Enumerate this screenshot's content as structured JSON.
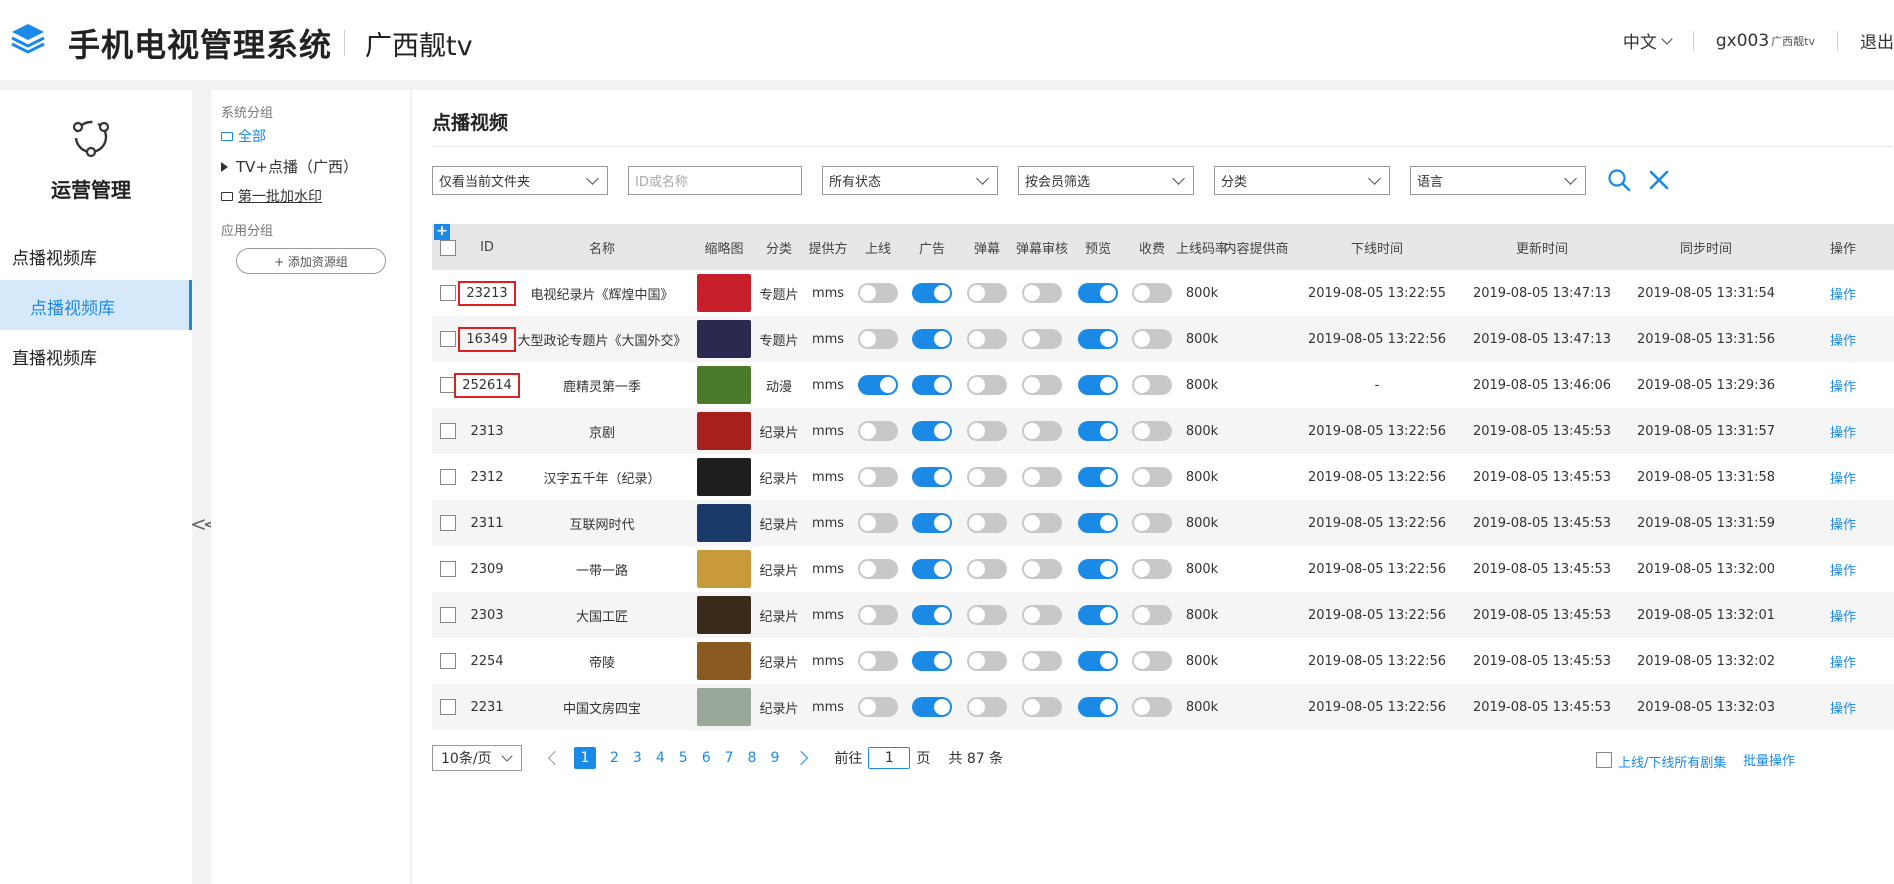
{
  "header": {
    "app_title": "手机电视管理系统",
    "org_name": "广西靓tv",
    "language": "中文",
    "user": "gx003",
    "user_org": "广西靓tv",
    "logout": "退出"
  },
  "leftnav": {
    "title": "运营管理",
    "group1": "点播视频库",
    "active_item": "点播视频库",
    "group2": "直播视频库",
    "collapse": "<<"
  },
  "tree": {
    "system_label": "系统分组",
    "all": "全部",
    "tv_node": "TV+点播（广西）",
    "watermark_node": "第一批加水印",
    "app_label": "应用分组",
    "add_group": "+ 添加资源组"
  },
  "main": {
    "title": "点播视频",
    "filters": {
      "scope": "仅看当前文件夹",
      "search_placeholder": "ID或名称",
      "status": "所有状态",
      "member": "按会员筛选",
      "category": "分类",
      "language": "语言"
    }
  },
  "table": {
    "plus": "+",
    "headers": {
      "id": "ID",
      "name": "名称",
      "thumb": "缩略图",
      "category": "分类",
      "provider": "提供方",
      "online": "上线",
      "ad": "广告",
      "danmu": "弹幕",
      "danmu_review": "弹幕审核",
      "preview": "预览",
      "charge": "收费",
      "bitrate": "上线码率",
      "cp": "内容提供商",
      "offline_time": "下线时间",
      "update_time": "更新时间",
      "sync_time": "同步时间",
      "op": "操作"
    },
    "rows": [
      {
        "id": "23213",
        "name": "电视纪录片《辉煌中国》",
        "category": "专题片",
        "provider": "mms",
        "online": false,
        "ad": true,
        "danmu": false,
        "danmu_review": false,
        "preview": true,
        "charge": false,
        "bitrate": "800k",
        "offline_time": "2019-08-05 13:22:55",
        "update_time": "2019-08-05 13:47:13",
        "sync_time": "2019-08-05 13:31:54",
        "op": "操作",
        "thumb_color": "#c8202a",
        "highlight": true
      },
      {
        "id": "16349",
        "name": "大型政论专题片《大国外交》",
        "category": "专题片",
        "provider": "mms",
        "online": false,
        "ad": true,
        "danmu": false,
        "danmu_review": false,
        "preview": true,
        "charge": false,
        "bitrate": "800k",
        "offline_time": "2019-08-05 13:22:56",
        "update_time": "2019-08-05 13:47:13",
        "sync_time": "2019-08-05 13:31:56",
        "op": "操作",
        "thumb_color": "#2a2a50",
        "highlight": true
      },
      {
        "id": "252614",
        "name": "鹿精灵第一季",
        "category": "动漫",
        "provider": "mms",
        "online": true,
        "ad": true,
        "danmu": false,
        "danmu_review": false,
        "preview": true,
        "charge": false,
        "bitrate": "800k",
        "offline_time": "-",
        "update_time": "2019-08-05 13:46:06",
        "sync_time": "2019-08-05 13:29:36",
        "op": "操作",
        "thumb_color": "#4a7a2a",
        "highlight": true
      },
      {
        "id": "2313",
        "name": "京剧",
        "category": "纪录片",
        "provider": "mms",
        "online": false,
        "ad": true,
        "danmu": false,
        "danmu_review": false,
        "preview": true,
        "charge": false,
        "bitrate": "800k",
        "offline_time": "2019-08-05 13:22:56",
        "update_time": "2019-08-05 13:45:53",
        "sync_time": "2019-08-05 13:31:57",
        "op": "操作",
        "thumb_color": "#a8201e",
        "highlight": false
      },
      {
        "id": "2312",
        "name": "汉字五千年（纪录）",
        "category": "纪录片",
        "provider": "mms",
        "online": false,
        "ad": true,
        "danmu": false,
        "danmu_review": false,
        "preview": true,
        "charge": false,
        "bitrate": "800k",
        "offline_time": "2019-08-05 13:22:56",
        "update_time": "2019-08-05 13:45:53",
        "sync_time": "2019-08-05 13:31:58",
        "op": "操作",
        "thumb_color": "#1e1e1e",
        "highlight": false
      },
      {
        "id": "2311",
        "name": "互联网时代",
        "category": "纪录片",
        "provider": "mms",
        "online": false,
        "ad": true,
        "danmu": false,
        "danmu_review": false,
        "preview": true,
        "charge": false,
        "bitrate": "800k",
        "offline_time": "2019-08-05 13:22:56",
        "update_time": "2019-08-05 13:45:53",
        "sync_time": "2019-08-05 13:31:59",
        "op": "操作",
        "thumb_color": "#1a3a6a",
        "highlight": false
      },
      {
        "id": "2309",
        "name": "一带一路",
        "category": "纪录片",
        "provider": "mms",
        "online": false,
        "ad": true,
        "danmu": false,
        "danmu_review": false,
        "preview": true,
        "charge": false,
        "bitrate": "800k",
        "offline_time": "2019-08-05 13:22:56",
        "update_time": "2019-08-05 13:45:53",
        "sync_time": "2019-08-05 13:32:00",
        "op": "操作",
        "thumb_color": "#c89a3a",
        "highlight": false
      },
      {
        "id": "2303",
        "name": "大国工匠",
        "category": "纪录片",
        "provider": "mms",
        "online": false,
        "ad": true,
        "danmu": false,
        "danmu_review": false,
        "preview": true,
        "charge": false,
        "bitrate": "800k",
        "offline_time": "2019-08-05 13:22:56",
        "update_time": "2019-08-05 13:45:53",
        "sync_time": "2019-08-05 13:32:01",
        "op": "操作",
        "thumb_color": "#3a2a1a",
        "highlight": false
      },
      {
        "id": "2254",
        "name": "帝陵",
        "category": "纪录片",
        "provider": "mms",
        "online": false,
        "ad": true,
        "danmu": false,
        "danmu_review": false,
        "preview": true,
        "charge": false,
        "bitrate": "800k",
        "offline_time": "2019-08-05 13:22:56",
        "update_time": "2019-08-05 13:45:53",
        "sync_time": "2019-08-05 13:32:02",
        "op": "操作",
        "thumb_color": "#8a5a20",
        "highlight": false
      },
      {
        "id": "2231",
        "name": "中国文房四宝",
        "category": "纪录片",
        "provider": "mms",
        "online": false,
        "ad": true,
        "danmu": false,
        "danmu_review": false,
        "preview": true,
        "charge": false,
        "bitrate": "800k",
        "offline_time": "2019-08-05 13:22:56",
        "update_time": "2019-08-05 13:45:53",
        "sync_time": "2019-08-05 13:32:03",
        "op": "操作",
        "thumb_color": "#9aa89a",
        "highlight": false
      }
    ]
  },
  "pager": {
    "page_size": "10条/页",
    "pages": [
      "1",
      "2",
      "3",
      "4",
      "5",
      "6",
      "7",
      "8",
      "9"
    ],
    "current": "1",
    "goto_label": "前往",
    "goto_value": "1",
    "page_unit": "页",
    "total": "共 87 条",
    "bulk_label": "上线/下线所有剧集",
    "bulk_button": "批量操作"
  },
  "colors": {
    "accent": "#1a8ae6",
    "highlight_border": "#e02020"
  }
}
